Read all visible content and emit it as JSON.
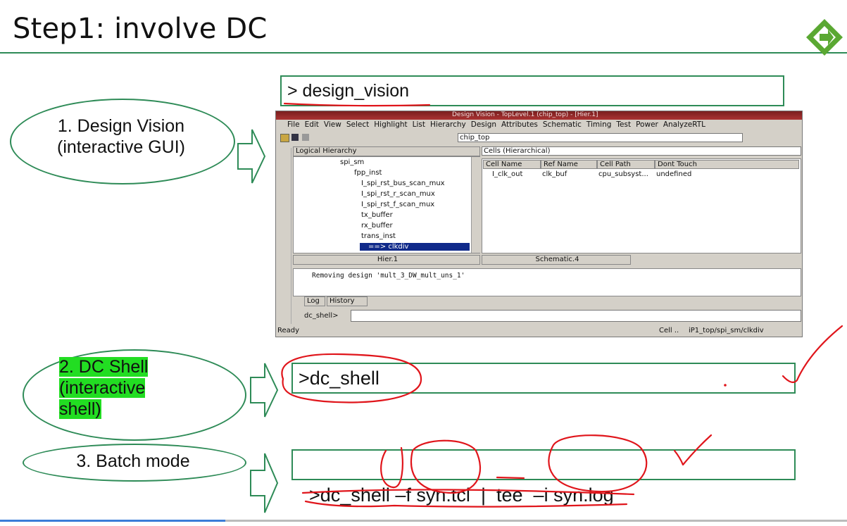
{
  "slide": {
    "title": "Step1: involve DC",
    "logo_icon": "diamond-arrow-logo",
    "accent_color": "#2e8b57",
    "annotation_color": "#e0151b",
    "highlight_color": "#22dd22"
  },
  "modes": [
    {
      "line1": "1. Design Vision",
      "line2": "(interactive GUI)"
    },
    {
      "line1": "2. DC Shell",
      "line2": "(interactive",
      "line3": "shell)"
    },
    {
      "line1": "3. Batch mode"
    }
  ],
  "commands": {
    "design_vision": "> design_vision",
    "dc_shell": ">dc_shell",
    "batch": {
      "prompt": ">dc_shell ",
      "flag_f": "–f",
      "script": "syn.tcl",
      "pipe": "|",
      "tee": "tee",
      "flag_i": "–i",
      "log": "syn.log"
    }
  },
  "gui": {
    "window_title": "Design Vision - TopLevel.1 (chip_top) - [Hier.1]",
    "menu": [
      "File",
      "Edit",
      "View",
      "Select",
      "Highlight",
      "List",
      "Hierarchy",
      "Design",
      "Attributes",
      "Schematic",
      "Timing",
      "Test",
      "Power",
      "AnalyzeRTL"
    ],
    "design_select": "chip_top",
    "hier_header": "Logical Hierarchy",
    "tree": [
      "spi_sm",
      "fpp_inst",
      "I_spi_rst_bus_scan_mux",
      "I_spi_rst_r_scan_mux",
      "I_spi_rst_f_scan_mux",
      "tx_buffer",
      "rx_buffer",
      "trans_inst",
      "==> clkdiv"
    ],
    "cells_select": "Cells (Hierarchical)",
    "cells_columns": [
      "Cell Name",
      "Ref Name",
      "Cell Path",
      "Dont Touch"
    ],
    "cells_row": [
      "I_clk_out",
      "clk_buf",
      "cpu_subsyst...",
      "undefined"
    ],
    "tab_hier": "Hier.1",
    "tab_schematic": "Schematic.4",
    "log_text": "Removing design 'mult_3_DW_mult_uns_1'",
    "log_tab": "Log",
    "history_tab": "History",
    "prompt": "dc_shell>",
    "status_ready": "Ready",
    "status_cell": "Cell ..",
    "status_path": "iP1_top/spi_sm/clkdiv"
  }
}
